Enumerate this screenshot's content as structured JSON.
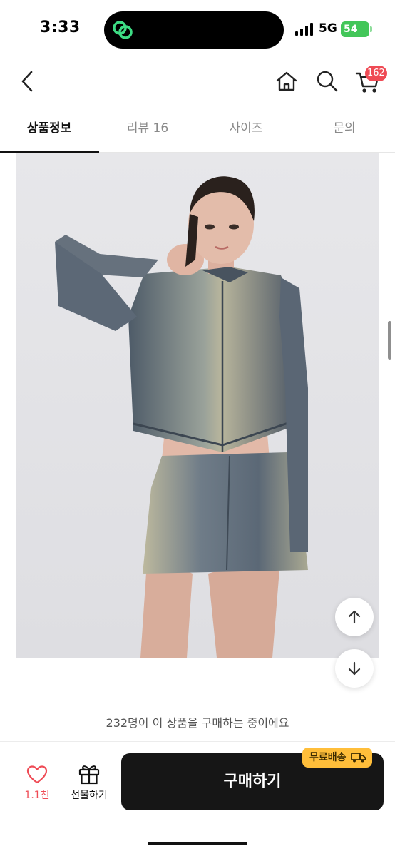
{
  "status_bar": {
    "time": "3:33",
    "network": "5G",
    "battery": "54"
  },
  "nav": {
    "cart_count": "162"
  },
  "tabs": [
    {
      "label": "상품정보",
      "active": true
    },
    {
      "label": "리뷰 16",
      "active": false
    },
    {
      "label": "사이즈",
      "active": false
    },
    {
      "label": "문의",
      "active": false
    }
  ],
  "product_image": {
    "alt_colors": {
      "background": "#e5e5e7",
      "denim": "#5d6a78",
      "denim_light": "#b7b59a",
      "skin": "#e0b8a8",
      "hair": "#2a211d"
    }
  },
  "notice": {
    "text": "232명이 이 상품을 구매하는 중이에요"
  },
  "action_bar": {
    "like_count": "1.1천",
    "gift_label": "선물하기",
    "buy_label": "구매하기",
    "free_shipping_label": "무료배송"
  },
  "colors": {
    "accent_red": "#ef4b55",
    "buy_button": "#161616",
    "free_shipping": "#ffbe3a",
    "battery": "#43c659"
  },
  "icons": [
    "back-icon",
    "home-icon",
    "search-icon",
    "cart-icon",
    "heart-icon",
    "gift-icon",
    "arrow-up-icon",
    "arrow-down-icon",
    "truck-icon"
  ]
}
